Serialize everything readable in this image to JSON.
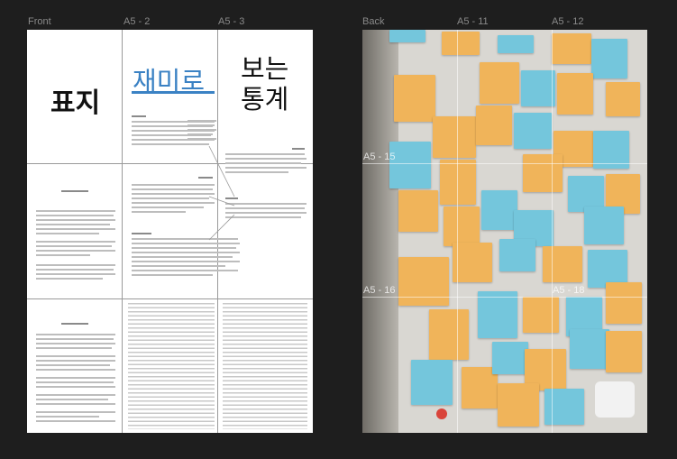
{
  "labels": {
    "front": "Front",
    "a5_2": "A5 - 2",
    "a5_3": "A5 - 3",
    "back": "Back",
    "a5_11": "A5 - 11",
    "a5_12": "A5 - 12",
    "a5_15": "A5 - 15",
    "a5_16": "A5 - 16",
    "a5_18": "A5 - 18"
  },
  "front_page": {
    "cover_title": "표지",
    "title_part1": "재미로",
    "title_part2": "보는",
    "title_part3": "통계",
    "accent_color": "#3b82c4"
  },
  "back_page": {
    "note_colors": [
      "#f0b45a",
      "#74c6dc"
    ]
  }
}
